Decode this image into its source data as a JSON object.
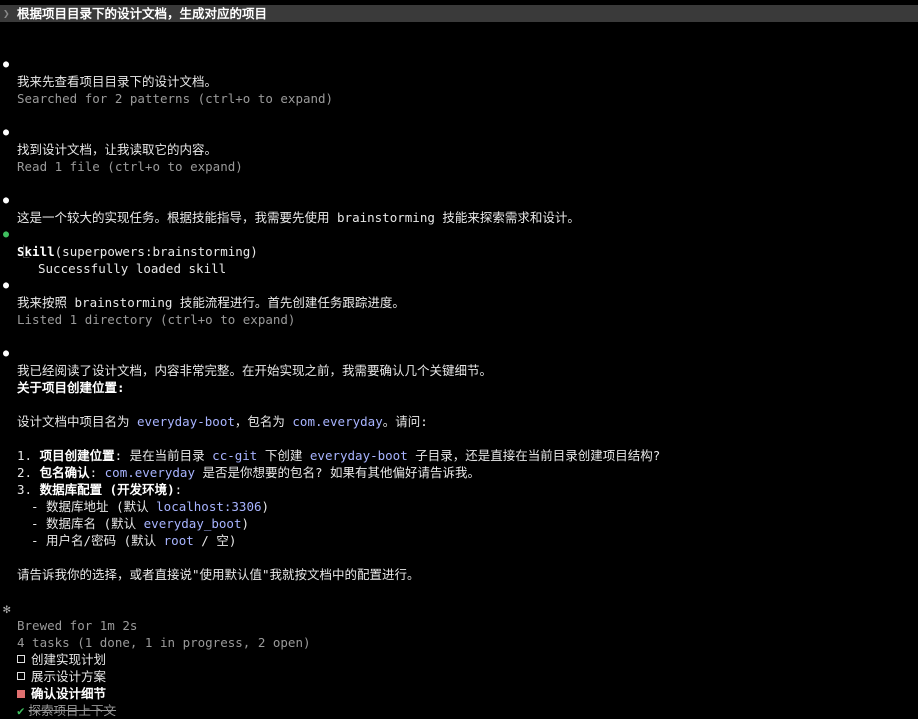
{
  "prompt": {
    "text": "根据项目目录下的设计文档，生成对应的项目"
  },
  "messages": {
    "m1": "我来先查看项目目录下的设计文档。",
    "tool1": "Searched for 2 patterns (ctrl+o to expand)",
    "m2": "找到设计文档，让我读取它的内容。",
    "tool2": "Read 1 file (ctrl+o to expand)",
    "m3a": "这是一个较大的实现任务。根据技能指导，我需要先使用 ",
    "m3code": "brainstorming",
    "m3b": " 技能来探索需求和设计。",
    "skill_name": "Skill",
    "skill_arg": "(superpowers:brainstorming)",
    "skill_result": "Successfully loaded skill",
    "m4a": "我来按照 ",
    "m4code": "brainstorming",
    "m4b": " 技能流程进行。首先创建任务跟踪进度。",
    "tool3": "Listed 1 directory (ctrl+o to expand)",
    "m5": "我已经阅读了设计文档，内容非常完整。在开始实现之前，我需要确认几个关键细节。",
    "heading": "关于项目创建位置:",
    "intro_a": "设计文档中项目名为 ",
    "intro_code1": "everyday-boot",
    "intro_b": "，包名为 ",
    "intro_code2": "com.everyday",
    "intro_c": "。请问:",
    "q1_num": "1. ",
    "q1_bold": "项目创建位置",
    "q1_a": ": 是在当前目录 ",
    "q1_code1": "cc-git",
    "q1_b": " 下创建 ",
    "q1_code2": "everyday-boot",
    "q1_c": " 子目录，还是直接在当前目录创建项目结构?",
    "q2_num": "2. ",
    "q2_bold": "包名确认",
    "q2_a": ": ",
    "q2_code": "com.everyday",
    "q2_b": " 是否是你想要的包名? 如果有其他偏好请告诉我。",
    "q3_num": "3. ",
    "q3_bold": "数据库配置 (开发环境)",
    "q3_a": ":",
    "q3_i1a": "- 数据库地址 (默认 ",
    "q3_i1code": "localhost:3306",
    "q3_i1b": ")",
    "q3_i2a": "- 数据库名 (默认 ",
    "q3_i2code": "everyday_boot",
    "q3_i2b": ")",
    "q3_i3a": "- 用户名/密码 (默认 ",
    "q3_i3code": "root",
    "q3_i3b": " / 空)",
    "closing": "请告诉我你的选择，或者直接说\"使用默认值\"我就按文档中的配置进行。"
  },
  "status": {
    "brewed": "Brewed for 1m 2s"
  },
  "tasks": {
    "summary": "4 tasks (1 done, 1 in progress, 2 open)",
    "items": [
      {
        "label": "创建实现计划",
        "state": "open"
      },
      {
        "label": "展示设计方案",
        "state": "open"
      },
      {
        "label": "确认设计细节",
        "state": "in_progress"
      },
      {
        "label": "探索项目上下文",
        "state": "done"
      }
    ]
  },
  "colors": {
    "accent_code": "#a8b4ff",
    "bullet_green": "#3fbf5f",
    "progress_red": "#e07070"
  }
}
